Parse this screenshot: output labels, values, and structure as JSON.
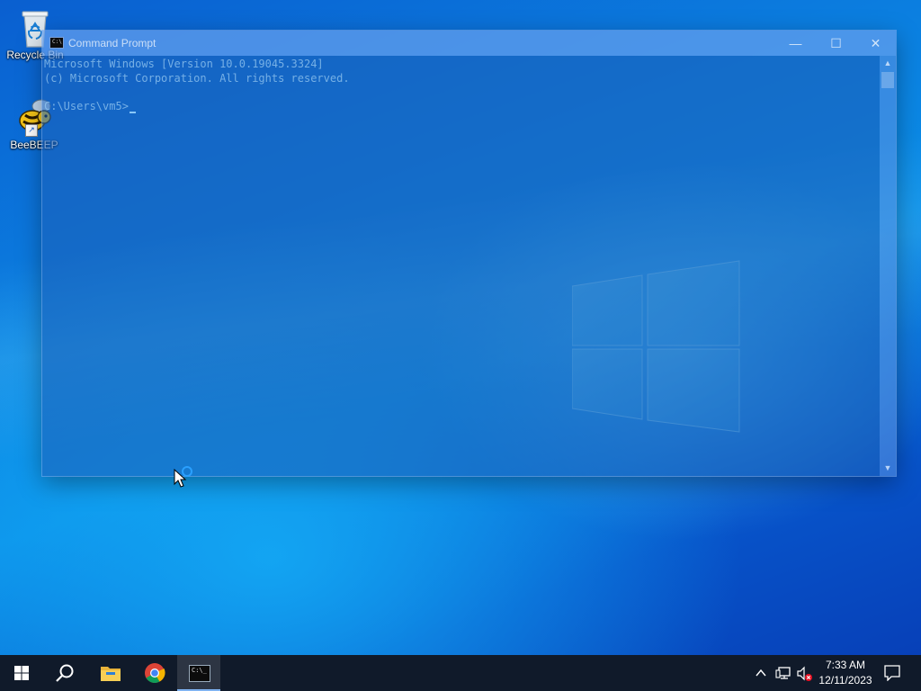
{
  "desktop": {
    "icons": [
      {
        "label": "Recycle Bin",
        "icon": "recycle-bin-icon"
      },
      {
        "label": "BeeBEEP",
        "icon": "beebeep-icon"
      }
    ]
  },
  "cmd_window": {
    "title": "Command Prompt",
    "icon": "cmd-icon",
    "buttons": {
      "minimize": "—",
      "maximize": "☐",
      "close": "✕"
    },
    "lines": [
      "Microsoft Windows [Version 10.0.19045.3324]",
      "(c) Microsoft Corporation. All rights reserved.",
      "",
      "C:\\Users\\vm5>"
    ]
  },
  "taskbar": {
    "items": [
      {
        "name": "start",
        "icon": "windows-start-icon"
      },
      {
        "name": "search",
        "icon": "search-icon"
      },
      {
        "name": "file-explorer",
        "icon": "folder-icon"
      },
      {
        "name": "chrome",
        "icon": "chrome-icon"
      },
      {
        "name": "command-prompt",
        "icon": "cmd-icon",
        "active": true
      }
    ],
    "tray": {
      "clock_time": "7:33 AM",
      "clock_date": "12/11/2023",
      "icons": [
        "chevron-up-icon",
        "network-icon",
        "volume-muted-icon",
        "notification-icon"
      ]
    }
  },
  "colors": {
    "taskbar_bg": "#101a2a",
    "desktop_accent": "#0b7fe0",
    "active_indicator": "#7fb2f0"
  }
}
